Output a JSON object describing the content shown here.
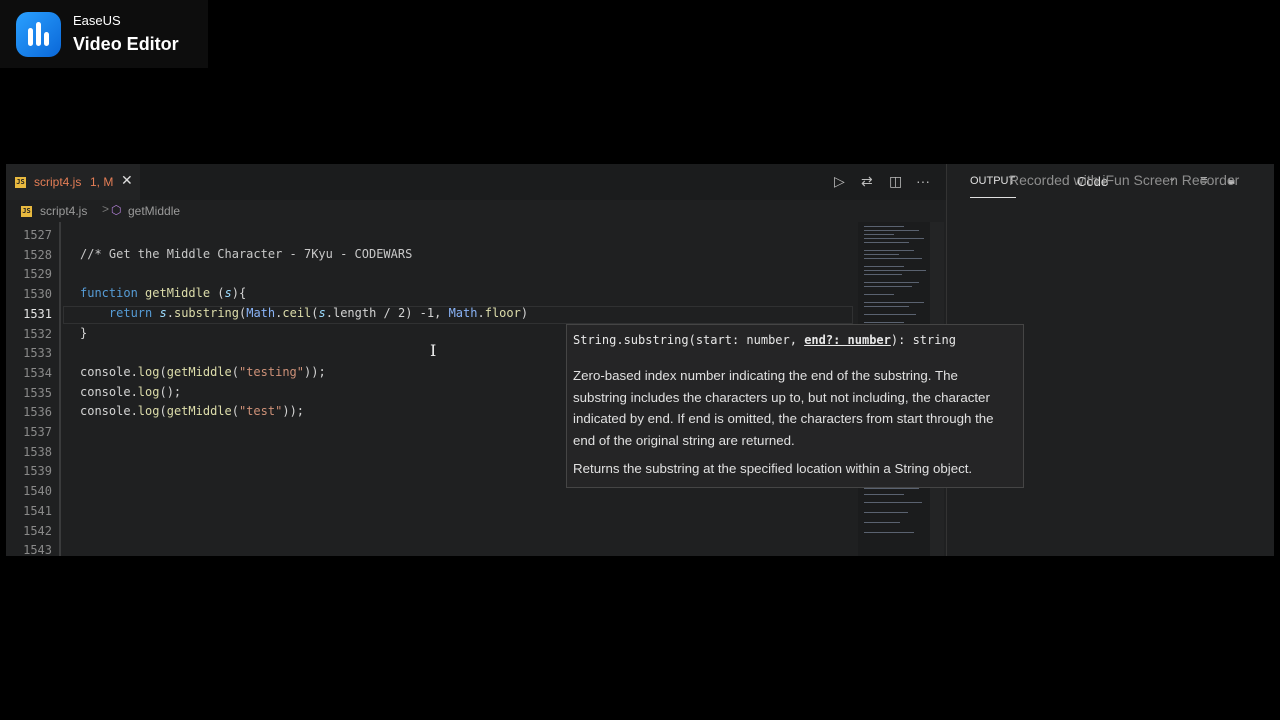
{
  "overlay": {
    "brand_top": "EaseUS",
    "brand_bottom": "Video Editor",
    "watermark": "Recorded with iFun Screen Recorder"
  },
  "tab": {
    "icon": "js-file-icon",
    "title": "script4.js",
    "status": "1, M",
    "close": "✕"
  },
  "breadcrumb": {
    "file": "script4.js",
    "separator": ">",
    "symbol": "getMiddle"
  },
  "editor": {
    "line_numbers": [
      "1527",
      "1528",
      "1529",
      "1530",
      "1531",
      "1532",
      "1533",
      "1534",
      "1535",
      "1536",
      "1537",
      "1538",
      "1539",
      "1540",
      "1541",
      "1542",
      "1543"
    ],
    "active_line": "1531",
    "code": {
      "l1528": "//* Get the Middle Character - 7Kyu - CODEWARS",
      "l1530_kw": "function",
      "l1530_fn": "getMiddle",
      "l1530_open": " (",
      "l1530_param": "s",
      "l1530_close": "){",
      "l1531_kw": "return",
      "l1531_s": "s",
      "l1531_dot1": ".",
      "l1531_sub": "substring",
      "l1531_p1": "(",
      "l1531_math1": "Math",
      "l1531_dot2": ".",
      "l1531_ceil": "ceil",
      "l1531_p2": "(",
      "l1531_s2": "s",
      "l1531_len": ".length / 2) -1, ",
      "l1531_math2": "Math",
      "l1531_dot3": ".",
      "l1531_floor": "floor",
      "l1531_p3": ")",
      "l1532": "}",
      "l1534_a": "console.",
      "l1534_log": "log",
      "l1534_b": "(",
      "l1534_fn": "getMiddle",
      "l1534_c": "(",
      "l1534_str": "\"testing\"",
      "l1534_d": "));",
      "l1535_a": "console.",
      "l1535_log": "log",
      "l1535_b": "();",
      "l1536_a": "console.",
      "l1536_log": "log",
      "l1536_b": "(",
      "l1536_fn": "getMiddle",
      "l1536_c": "(",
      "l1536_str": "\"test\"",
      "l1536_d": "));"
    }
  },
  "hover": {
    "sig_a": "String.substring(start: number, ",
    "sig_param": "end?: number",
    "sig_b": "): string",
    "description": "Zero-based index number indicating the end of the substring. The substring includes the characters up to, but not including, the character indicated by end. If end is omitted, the characters from start through the end of the original string are returned.",
    "returns": "Returns the substring at the specified location within a String object."
  },
  "panel": {
    "title": "OUTPUT",
    "dropdown": "Code"
  },
  "icons": {
    "run": "run-icon",
    "compare": "open-changes-icon",
    "split": "split-editor-icon",
    "more": "more-icon",
    "symbol": "method-symbol-icon",
    "clear": "clear-output-icon",
    "lock": "lock-scroll-icon"
  }
}
